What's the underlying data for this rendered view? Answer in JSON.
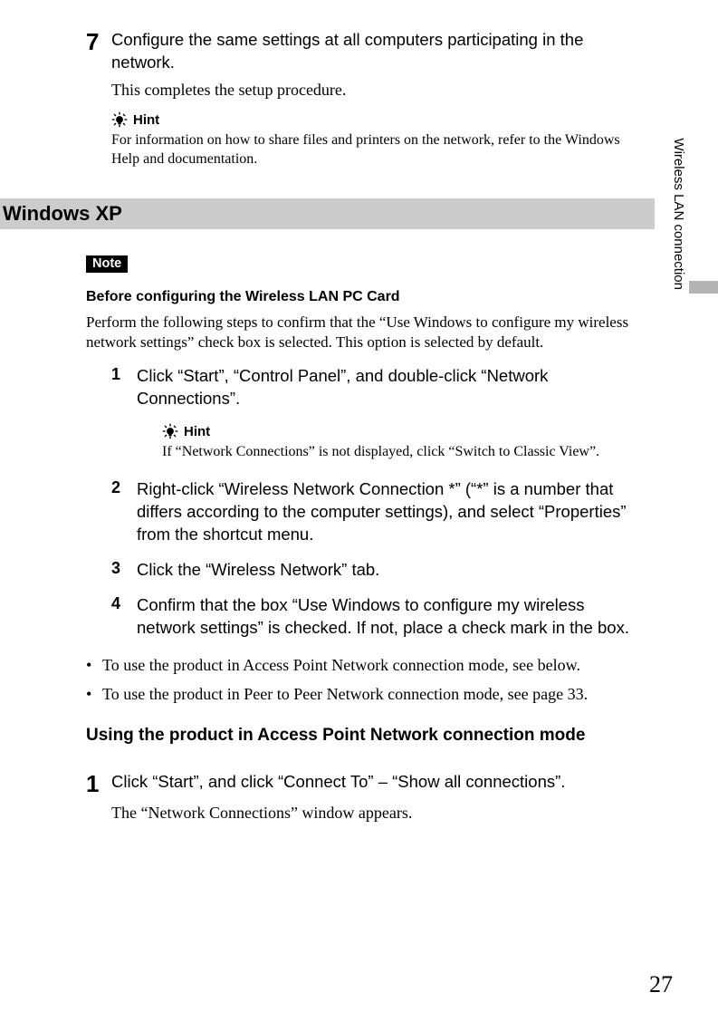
{
  "side_label": "Wireless LAN connection",
  "top_step": {
    "num": "7",
    "text": "Configure the same settings at all computers participating in the network.",
    "after": "This completes the setup procedure.",
    "hint_label": "Hint",
    "hint_text": "For information on how to share files and printers on the network, refer to the Windows Help and documentation."
  },
  "section_bar": "Windows XP",
  "note_label": "Note",
  "pre_heading": "Before configuring the Wireless LAN PC Card",
  "pre_intro": "Perform the following steps to confirm that the “Use Windows to configure my wireless network settings” check box is selected. This option is selected by default.",
  "steps": [
    {
      "num": "1",
      "text": "Click “Start”, “Control Panel”, and double-click “Network Connections”.",
      "hint_label": "Hint",
      "hint_text": "If “Network Connections” is not displayed, click “Switch to Classic View”."
    },
    {
      "num": "2",
      "text": "Right-click “Wireless Network Connection *” (“*” is a number that differs according to the computer settings), and select “Properties” from the shortcut menu."
    },
    {
      "num": "3",
      "text": "Click the “Wireless Network” tab."
    },
    {
      "num": "4",
      "text": "Confirm that the box “Use Windows to configure my wireless network settings” is checked. If not, place a check mark in the box."
    }
  ],
  "bullets": [
    "To use the product in Access Point Network connection mode, see below.",
    "To use the product in Peer to Peer Network connection mode, see page 33."
  ],
  "ap_title": "Using the product in Access Point Network connection mode",
  "ap_step": {
    "num": "1",
    "text": "Click “Start”, and click “Connect To” – “Show all connections”.",
    "after": "The “Network Connections” window appears."
  },
  "page_number": "27"
}
